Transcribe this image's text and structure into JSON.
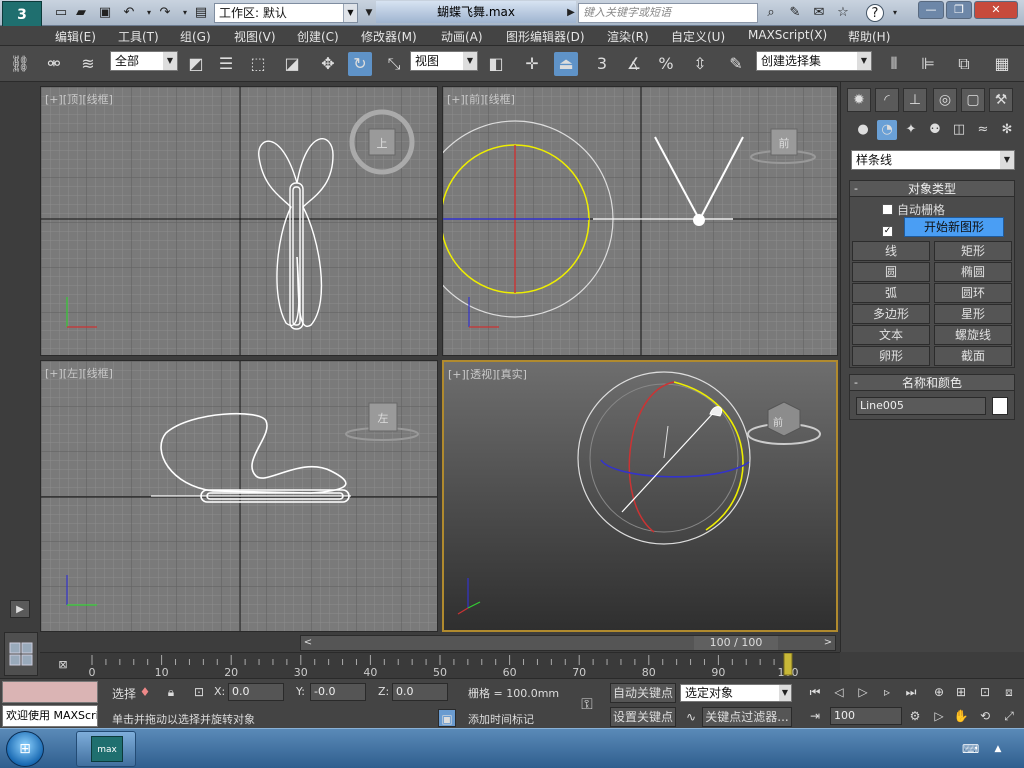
{
  "title_bar": {
    "app_logo": "3",
    "workspace_label": "工作区: 默认",
    "document_title": "蝴蝶飞舞.max",
    "search_placeholder": "键入关键字或短语"
  },
  "menu": [
    "编辑(E)",
    "工具(T)",
    "组(G)",
    "视图(V)",
    "创建(C)",
    "修改器(M)",
    "动画(A)",
    "图形编辑器(D)",
    "渲染(R)",
    "自定义(U)",
    "MAXScript(X)",
    "帮助(H)"
  ],
  "toolbar": {
    "filter_label": "全部",
    "ref_coord_label": "视图",
    "named_selection_label": "创建选择集",
    "snap_3": "3",
    "percent": "%"
  },
  "viewports": {
    "top": {
      "label": "[+][顶][线框]",
      "cube_label": "上"
    },
    "front": {
      "label": "[+][前][线框]",
      "cube_label": "前"
    },
    "left": {
      "label": "[+][左][线框]",
      "cube_label": "左"
    },
    "persp": {
      "label": "[+][透视][真实]",
      "cube_label": "前"
    }
  },
  "command_panel": {
    "category_label": "样条线",
    "object_type_title": "对象类型",
    "auto_grid_label": "自动栅格",
    "start_new_shape_label": "开始新图形",
    "buttons": [
      "线",
      "矩形",
      "圆",
      "椭圆",
      "弧",
      "圆环",
      "多边形",
      "星形",
      "文本",
      "螺旋线",
      "卵形",
      "截面"
    ],
    "name_color_title": "名称和颜色",
    "object_name": "Line005",
    "object_color": "#ffffff"
  },
  "timeline": {
    "frame_display": "100 / 100",
    "current_frame": 100,
    "total_frames": 100,
    "ruler_labels": [
      "0",
      "10",
      "20",
      "30",
      "40",
      "50",
      "60",
      "70",
      "80",
      "90",
      "100"
    ]
  },
  "status": {
    "maxscript_text": "欢迎使用 MAXScri",
    "selection_label": "选择",
    "prompt_text": "单击并拖动以选择并旋转对象",
    "x_label": "X:",
    "x_value": "0.0",
    "y_label": "Y:",
    "y_value": "-0.0",
    "z_label": "Z:",
    "z_value": "0.0",
    "grid_text": "栅格 = 100.0mm",
    "add_time_tag": "添加时间标记",
    "auto_key": "自动关键点",
    "set_key": "设置关键点",
    "selected_object": "选定对象",
    "key_filters": "关键点过滤器...",
    "frame_field": "100"
  }
}
